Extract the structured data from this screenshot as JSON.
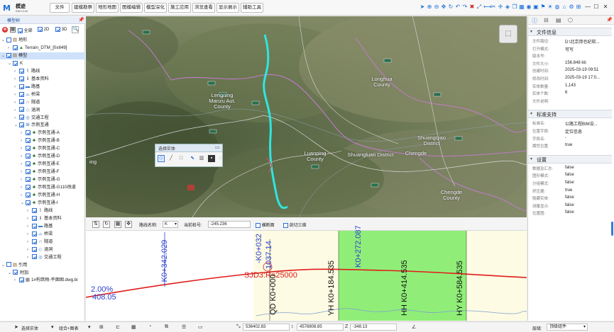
{
  "app": {
    "logo_mark": "M",
    "logo_name": "模迹",
    "logo_sub": "BIM Draft"
  },
  "menu": [
    {
      "label": "文件"
    },
    {
      "label": "建模勘察"
    },
    {
      "label": "地形地图"
    },
    {
      "label": "图模编辑"
    },
    {
      "label": "模型深化"
    },
    {
      "label": "施工应用"
    },
    {
      "label": "浏览查看"
    },
    {
      "label": "显示展示"
    },
    {
      "label": "辅助工具"
    }
  ],
  "left_panel": {
    "title": "模型树",
    "filters": [
      {
        "label": "全部"
      },
      {
        "label": "2D"
      },
      {
        "label": "3D"
      }
    ],
    "tree": [
      {
        "label": "地形",
        "depth": 0,
        "icon": "folder-icon",
        "checked": false,
        "expanded": true
      },
      {
        "label": "Terrain_DTM_[0x849]",
        "depth": 1,
        "icon": "terrain-icon",
        "checked": true
      },
      {
        "label": "模型",
        "depth": 0,
        "icon": "folder-icon",
        "checked": true,
        "expanded": true,
        "selected": true
      },
      {
        "label": "K",
        "depth": 1,
        "icon": "",
        "checked": true,
        "expanded": true
      },
      {
        "label": "路线",
        "depth": 2,
        "icon": "route-icon",
        "checked": true
      },
      {
        "label": "基本资料",
        "depth": 2,
        "icon": "info-icon",
        "checked": true
      },
      {
        "label": "路基",
        "depth": 2,
        "icon": "roadbed-icon",
        "checked": true
      },
      {
        "label": "桥梁",
        "depth": 2,
        "icon": "bridge-icon",
        "checked": true
      },
      {
        "label": "隧道",
        "depth": 2,
        "icon": "tunnel-icon",
        "checked": true
      },
      {
        "label": "涵洞",
        "depth": 2,
        "icon": "culvert-icon",
        "checked": true
      },
      {
        "label": "交通工程",
        "depth": 2,
        "icon": "traffic-icon",
        "checked": true
      },
      {
        "label": "示例互通",
        "depth": 2,
        "icon": "interchange-icon",
        "checked": true,
        "expanded": true
      },
      {
        "label": "示例互通-A",
        "depth": 3,
        "icon": "tree-icon",
        "checked": true
      },
      {
        "label": "示例互通-B",
        "depth": 3,
        "icon": "tree-icon",
        "checked": true
      },
      {
        "label": "示例互通-C",
        "depth": 3,
        "icon": "tree-icon",
        "checked": true
      },
      {
        "label": "示例互通-D",
        "depth": 3,
        "icon": "tree-icon",
        "checked": true
      },
      {
        "label": "示例互通-E",
        "depth": 3,
        "icon": "tree-icon",
        "checked": true
      },
      {
        "label": "示例互通-F",
        "depth": 3,
        "icon": "tree-icon",
        "checked": true
      },
      {
        "label": "示例互通-G",
        "depth": 3,
        "icon": "tree-icon",
        "checked": true
      },
      {
        "label": "示例互通-G110改道",
        "depth": 3,
        "icon": "tree-icon",
        "checked": true
      },
      {
        "label": "示例互通-H",
        "depth": 3,
        "icon": "tree-icon",
        "checked": true
      },
      {
        "label": "示例互通-I",
        "depth": 3,
        "icon": "tree-icon",
        "checked": true,
        "expanded": true
      },
      {
        "label": "路线",
        "depth": 4,
        "icon": "route-icon",
        "checked": true
      },
      {
        "label": "基本资料",
        "depth": 4,
        "icon": "info-icon",
        "checked": true
      },
      {
        "label": "路基",
        "depth": 4,
        "icon": "roadbed-icon",
        "checked": true
      },
      {
        "label": "桥梁",
        "depth": 4,
        "icon": "bridge-icon",
        "checked": true
      },
      {
        "label": "隧道",
        "depth": 4,
        "icon": "tunnel-icon",
        "checked": true
      },
      {
        "label": "涵洞",
        "depth": 4,
        "icon": "culvert-icon",
        "checked": true
      },
      {
        "label": "交通工程",
        "depth": 4,
        "icon": "traffic-icon",
        "checked": true
      },
      {
        "label": "引用",
        "depth": 0,
        "icon": "folder-icon",
        "checked": false,
        "expanded": true
      },
      {
        "label": "附加",
        "depth": 1,
        "icon": "",
        "checked": true,
        "expanded": true
      },
      {
        "label": "1#构筑物-平面图.dwg.bi",
        "depth": 2,
        "icon": "file-icon",
        "checked": true
      }
    ]
  },
  "map": {
    "labels": [
      {
        "text": "Lengning\nManzu Aut.\nCounty"
      },
      {
        "text": "Longhua\nCounty"
      },
      {
        "text": "Luanping\nCounty"
      },
      {
        "text": "Shuangluan District"
      },
      {
        "text": "Shuangqiao\nDistrict"
      },
      {
        "text": "Chengde"
      },
      {
        "text": "Chengde\nCounty"
      },
      {
        "text": "ing"
      }
    ],
    "float_toolbar_title": "选择实体"
  },
  "profile": {
    "toolbar": {
      "route_name_label": "路线名称:",
      "route_name_value": "K",
      "station_label": "当前桩号:",
      "station_value": "-245.236",
      "chk1_label": "横断面",
      "chk2_label": "剖切三维"
    },
    "texts": [
      {
        "text": "-K0+342.029"
      },
      {
        "text": "-K0+032"
      },
      {
        "text": "1037.14"
      },
      {
        "text": "K0+272.087"
      },
      {
        "text": "SJD3:R=25000"
      },
      {
        "text": "2.00%"
      },
      {
        "text": "408.05"
      },
      {
        "text": "QD K0+000"
      },
      {
        "text": "YH K0+184.535"
      },
      {
        "text": "HH K0+414.535"
      },
      {
        "text": "HY K0+584.535"
      }
    ]
  },
  "right_panel": {
    "sections": [
      {
        "title": "文件信息",
        "props": [
          {
            "key": "文件路径:",
            "value": "D:\\北京拜也纪软..."
          },
          {
            "key": "打开模式:",
            "value": "可写"
          },
          {
            "key": "版本号:",
            "value": ""
          },
          {
            "key": "文件大小:",
            "value": "156.848 kb"
          },
          {
            "key": "创建时间:",
            "value": "2025-03-19 09:51"
          },
          {
            "key": "修改时间:",
            "value": "2025-03-19 17:0..."
          },
          {
            "key": "实体数量:",
            "value": "1,143"
          },
          {
            "key": "实体个数:",
            "value": "6"
          },
          {
            "key": "文件说明:",
            "value": ""
          }
        ]
      },
      {
        "title": "标准支持",
        "props": [
          {
            "key": "标准名:",
            "value": "公路工程BIM设..."
          },
          {
            "key": "位置字段:",
            "value": "定位信息"
          },
          {
            "key": "字段名:",
            "value": "-"
          },
          {
            "key": "属性位置:",
            "value": "true"
          }
        ]
      },
      {
        "title": "设置",
        "props": [
          {
            "key": "数据及汇总:",
            "value": "false"
          },
          {
            "key": "图形模式:",
            "value": "false"
          },
          {
            "key": "分组模式:",
            "value": "false"
          },
          {
            "key": "挤压据:",
            "value": "true"
          },
          {
            "key": "隐藏实体:",
            "value": "false"
          },
          {
            "key": "测量显示:",
            "value": "false"
          },
          {
            "key": "位置图:",
            "value": "false"
          }
        ]
      }
    ]
  },
  "status": {
    "select_label": "选择实体",
    "combo_label": "组合+图表",
    "x_value": "536402.83",
    "y_value": "4578808.85",
    "z_value": "-348.13",
    "level_label": "层级:",
    "level_value": "顶级组件"
  },
  "colors": {
    "accent": "#1b6fd8",
    "route": "#2ee6e0",
    "profile_line": "#e01b1b",
    "highlight": "#90ee78",
    "pale": "#fdfbe3"
  }
}
